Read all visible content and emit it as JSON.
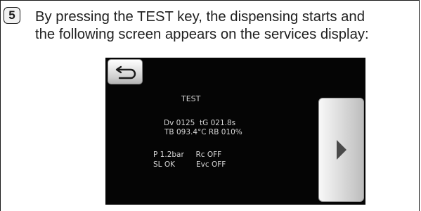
{
  "step": {
    "number": "5"
  },
  "instruction": {
    "line1": "By pressing the TEST key, the dispensing starts and",
    "line2": "the following screen appears on the services display:"
  },
  "display": {
    "title": "TEST",
    "line_dv": "Dv 0125  tG 021.8s",
    "line_tb": "TB 093.4°C RB 010%",
    "line_p": "P 1.2bar     Rc OFF",
    "line_sl": "SL OK         Evc OFF",
    "back_icon": "back-arrow-icon",
    "forward_icon": "play-triangle-icon"
  }
}
